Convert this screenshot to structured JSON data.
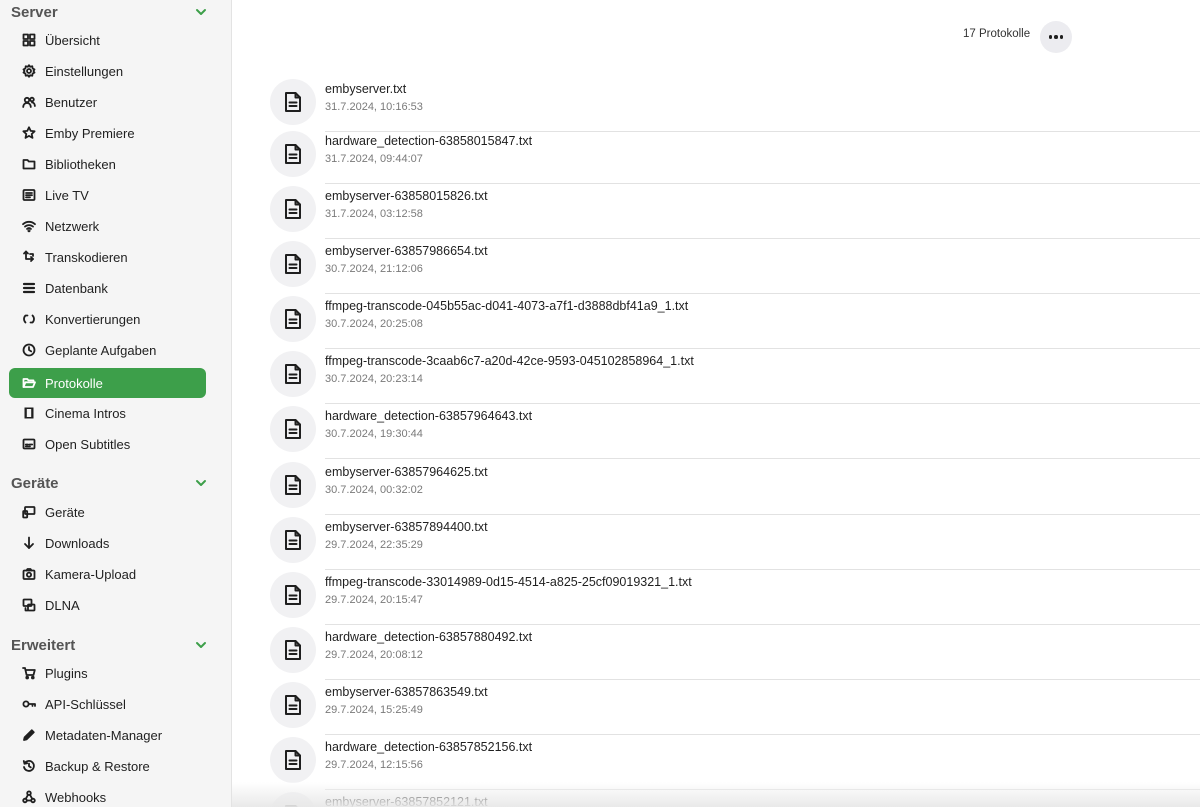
{
  "sidebar": {
    "sections": [
      {
        "title": "Server",
        "items": [
          {
            "label": "Übersicht",
            "icon": "dashboard-icon",
            "active": false
          },
          {
            "label": "Einstellungen",
            "icon": "gear-icon",
            "active": false
          },
          {
            "label": "Benutzer",
            "icon": "users-icon",
            "active": false
          },
          {
            "label": "Emby Premiere",
            "icon": "star-icon",
            "active": false
          },
          {
            "label": "Bibliotheken",
            "icon": "folder-icon",
            "active": false
          },
          {
            "label": "Live TV",
            "icon": "tv-guide-icon",
            "active": false
          },
          {
            "label": "Netzwerk",
            "icon": "wifi-icon",
            "active": false
          },
          {
            "label": "Transkodieren",
            "icon": "transcode-icon",
            "active": false
          },
          {
            "label": "Datenbank",
            "icon": "database-icon",
            "active": false
          },
          {
            "label": "Konvertierungen",
            "icon": "convert-icon",
            "active": false
          },
          {
            "label": "Geplante Aufgaben",
            "icon": "clock-icon",
            "active": false
          },
          {
            "label": "Protokolle",
            "icon": "folder-open-icon",
            "active": true
          },
          {
            "label": "Cinema Intros",
            "icon": "film-icon",
            "active": false
          },
          {
            "label": "Open Subtitles",
            "icon": "subtitles-icon",
            "active": false
          }
        ]
      },
      {
        "title": "Geräte",
        "items": [
          {
            "label": "Geräte",
            "icon": "devices-icon",
            "active": false
          },
          {
            "label": "Downloads",
            "icon": "download-arrow-icon",
            "active": false
          },
          {
            "label": "Kamera-Upload",
            "icon": "camera-icon",
            "active": false
          },
          {
            "label": "DLNA",
            "icon": "dlna-icon",
            "active": false
          }
        ]
      },
      {
        "title": "Erweitert",
        "items": [
          {
            "label": "Plugins",
            "icon": "cart-icon",
            "active": false
          },
          {
            "label": "API-Schlüssel",
            "icon": "key-icon",
            "active": false
          },
          {
            "label": "Metadaten-Manager",
            "icon": "pencil-icon",
            "active": false
          },
          {
            "label": "Backup & Restore",
            "icon": "restore-icon",
            "active": false
          },
          {
            "label": "Webhooks",
            "icon": "webhook-icon",
            "active": false
          }
        ]
      }
    ]
  },
  "header": {
    "count_label": "17 Protokolle",
    "more_icon": "more-horizontal-icon"
  },
  "logs": [
    {
      "name": "embyserver.txt",
      "date": "31.7.2024, 10:16:53"
    },
    {
      "name": "hardware_detection-63858015847.txt",
      "date": "31.7.2024, 09:44:07"
    },
    {
      "name": "embyserver-63858015826.txt",
      "date": "31.7.2024, 03:12:58"
    },
    {
      "name": "embyserver-63857986654.txt",
      "date": "30.7.2024, 21:12:06"
    },
    {
      "name": "ffmpeg-transcode-045b55ac-d041-4073-a7f1-d3888dbf41a9_1.txt",
      "date": "30.7.2024, 20:25:08"
    },
    {
      "name": "ffmpeg-transcode-3caab6c7-a20d-42ce-9593-045102858964_1.txt",
      "date": "30.7.2024, 20:23:14"
    },
    {
      "name": "hardware_detection-63857964643.txt",
      "date": "30.7.2024, 19:30:44"
    },
    {
      "name": "embyserver-63857964625.txt",
      "date": "30.7.2024, 00:32:02"
    },
    {
      "name": "embyserver-63857894400.txt",
      "date": "29.7.2024, 22:35:29"
    },
    {
      "name": "ffmpeg-transcode-33014989-0d15-4514-a825-25cf09019321_1.txt",
      "date": "29.7.2024, 20:15:47"
    },
    {
      "name": "hardware_detection-63857880492.txt",
      "date": "29.7.2024, 20:08:12"
    },
    {
      "name": "embyserver-63857863549.txt",
      "date": "29.7.2024, 15:25:49"
    },
    {
      "name": "hardware_detection-63857852156.txt",
      "date": "29.7.2024, 12:15:56"
    },
    {
      "name": "embyserver-63857852121.txt",
      "date": ""
    }
  ],
  "colors": {
    "accent": "#3d9f4a",
    "sidebar_bg": "#f5f5f5",
    "icon_circle_bg": "#f1f1f3"
  }
}
